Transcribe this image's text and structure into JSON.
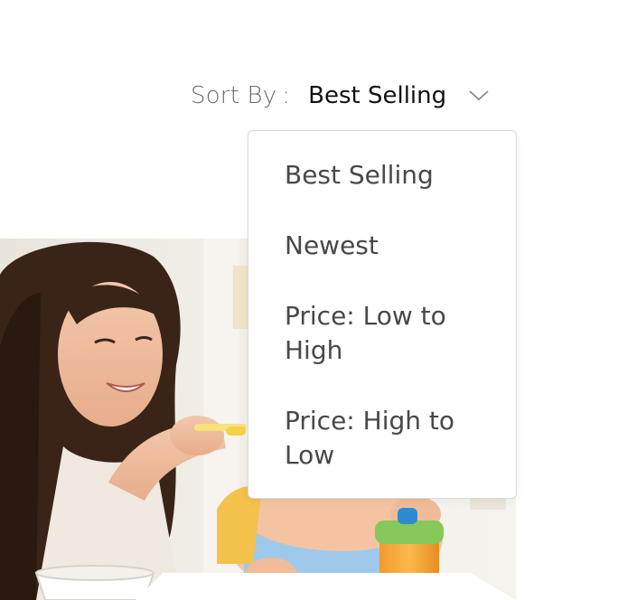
{
  "sort": {
    "label": "Sort By",
    "separator": ":",
    "selected": "Best Selling",
    "icon": "chevron-down-icon"
  },
  "dropdown": {
    "options": [
      "Best Selling",
      "Newest",
      "Price: Low to High",
      "Price: High to Low"
    ]
  },
  "product_image": {
    "description_icon": "photo"
  },
  "colors": {
    "label": "#6a6a6a",
    "value": "#111111",
    "option": "#484848",
    "border": "#d9d9d9"
  }
}
